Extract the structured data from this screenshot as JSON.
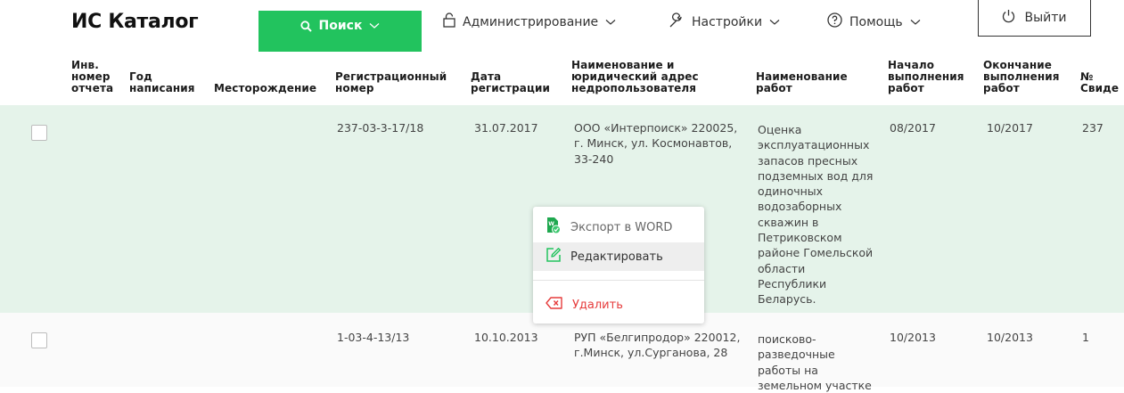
{
  "app": {
    "title": "ИС Каталог"
  },
  "nav": {
    "search_label": "Поиск",
    "admin_label": "Администрирование",
    "settings_label": "Настройки",
    "help_label": "Помощь",
    "logout_label": "Выйти",
    "accent_color": "#22c35e"
  },
  "table": {
    "headers": {
      "inv": [
        "Инв.",
        "номер",
        "отчета"
      ],
      "year": [
        "Год",
        "написания"
      ],
      "deposit": [
        "Месторождение"
      ],
      "regnum": [
        "Регистрационный",
        "номер"
      ],
      "regdate": [
        "Дата",
        "регистрации"
      ],
      "user": [
        "Наименование и",
        "юридический адрес",
        "недропользователя"
      ],
      "work": [
        "Наименование",
        "работ"
      ],
      "start": [
        "Начало",
        "выполнения",
        "работ"
      ],
      "end": [
        "Окончание",
        "выполнения",
        "работ"
      ],
      "cert": [
        "№",
        "Свиде"
      ]
    },
    "rows": [
      {
        "regnum": "237-03-3-17/18",
        "regdate": "31.07.2017",
        "user": [
          "ООО «Интерпоиск» 220025,",
          "г. Минск, ул. Космонавтов,",
          "33-240"
        ],
        "work": [
          "Оценка",
          "эксплуатационных",
          "запасов пресных",
          "подземных вод для",
          "одиночных",
          "водозаборных",
          "скважин в",
          "Петриковском",
          "районе Гомельской",
          "области",
          "Республики",
          "Беларусь."
        ],
        "start": "08/2017",
        "end": "10/2017",
        "cert": "237"
      },
      {
        "regnum": "1-03-4-13/13",
        "regdate": "10.10.2013",
        "user": [
          "РУП «Белгипродор» 220012,",
          "г.Минск, ул.Сурганова, 28"
        ],
        "work": [
          "поисково-",
          "разведочные",
          "работы на",
          "земельном участке"
        ],
        "start": "10/2013",
        "end": "10/2013",
        "cert": "1"
      }
    ]
  },
  "context_menu": {
    "export_label": "Экспорт в WORD",
    "edit_label": "Редактировать",
    "delete_label": "Удалить"
  }
}
